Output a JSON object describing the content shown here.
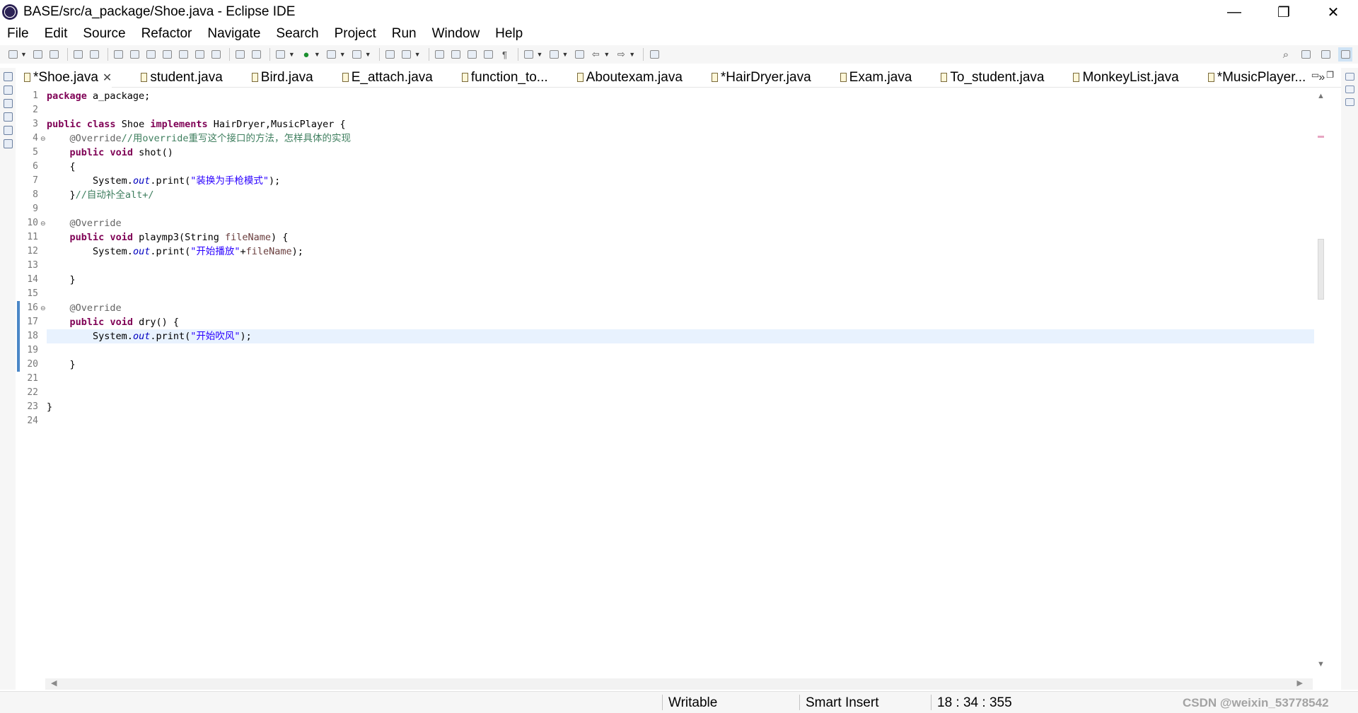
{
  "window": {
    "title": "BASE/src/a_package/Shoe.java - Eclipse IDE",
    "minimize_glyph": "—",
    "maximize_glyph": "❐",
    "close_glyph": "✕"
  },
  "menu": [
    "File",
    "Edit",
    "Source",
    "Refactor",
    "Navigate",
    "Search",
    "Project",
    "Run",
    "Window",
    "Help"
  ],
  "tabs": [
    {
      "label": "*Shoe.java",
      "active": true,
      "close": "✕"
    },
    {
      "label": "student.java"
    },
    {
      "label": "Bird.java"
    },
    {
      "label": "E_attach.java"
    },
    {
      "label": "function_to..."
    },
    {
      "label": "Aboutexam.java"
    },
    {
      "label": "*HairDryer.java"
    },
    {
      "label": "Exam.java"
    },
    {
      "label": "To_student.java"
    },
    {
      "label": "MonkeyList.java"
    },
    {
      "label": "*MusicPlayer..."
    }
  ],
  "tabs_overflow": "»",
  "line_numbers": [
    "1",
    "2",
    "3",
    "4",
    "5",
    "6",
    "7",
    "8",
    "9",
    "10",
    "11",
    "12",
    "13",
    "14",
    "15",
    "16",
    "17",
    "18",
    "19",
    "20",
    "21",
    "22",
    "23",
    "24"
  ],
  "code": {
    "l1": {
      "kw": "package",
      "rest": " a_package;"
    },
    "l3": {
      "kw1": "public",
      "kw2": "class",
      "name": " Shoe ",
      "kw3": "implements",
      "rest": " HairDryer,MusicPlayer {"
    },
    "l4": {
      "indent": "    ",
      "ann": "@Override",
      "cmt": "//用override重写这个接口的方法，怎样具体的实现"
    },
    "l5": {
      "indent": "    ",
      "kw1": "public",
      "kw2": "void",
      "rest": " shot()"
    },
    "l6": {
      "text": "    {"
    },
    "l7": {
      "indent": "        ",
      "pre": "System.",
      "fld": "out",
      "mid": ".print(",
      "str": "\"装换为手枪模式\"",
      "end": ");"
    },
    "l8": {
      "indent": "    ",
      "pre": "}",
      "cmt": "//自动补全alt+/"
    },
    "l10": {
      "indent": "    ",
      "ann": "@Override"
    },
    "l11": {
      "indent": "    ",
      "kw1": "public",
      "kw2": "void",
      "mid": " playmp3(String ",
      "prm": "fileName",
      "end": ") {"
    },
    "l12": {
      "indent": "        ",
      "pre": "System.",
      "fld": "out",
      "mid": ".print(",
      "str": "\"开始播放\"",
      "plus": "+",
      "prm": "fileName",
      "end": ");"
    },
    "l14": {
      "text": "    }"
    },
    "l16": {
      "indent": "    ",
      "ann": "@Override"
    },
    "l17": {
      "indent": "    ",
      "kw1": "public",
      "kw2": "void",
      "rest": " dry() {"
    },
    "l18": {
      "indent": "        ",
      "pre": "System.",
      "fld": "out",
      "mid": ".print(",
      "str": "\"开始吹风\"",
      "end": ");"
    },
    "l20": {
      "text": "    }"
    },
    "l23": {
      "text": "}"
    }
  },
  "status": {
    "writable": "Writable",
    "insert_mode": "Smart Insert",
    "position": "18 : 34 : 355"
  },
  "watermark": "CSDN @weixin_53778542",
  "colors": {
    "keyword": "#7f0055",
    "string": "#2a00ff",
    "comment": "#3f7f5f",
    "annotation": "#646464",
    "field": "#0000c0",
    "current_line": "#e8f2fe",
    "change_bar": "#4b87c7"
  },
  "icons": [
    "eclipse-logo-icon",
    "search-icon",
    "perspective-icon",
    "java-perspective-icon",
    "debug-perspective-icon"
  ]
}
